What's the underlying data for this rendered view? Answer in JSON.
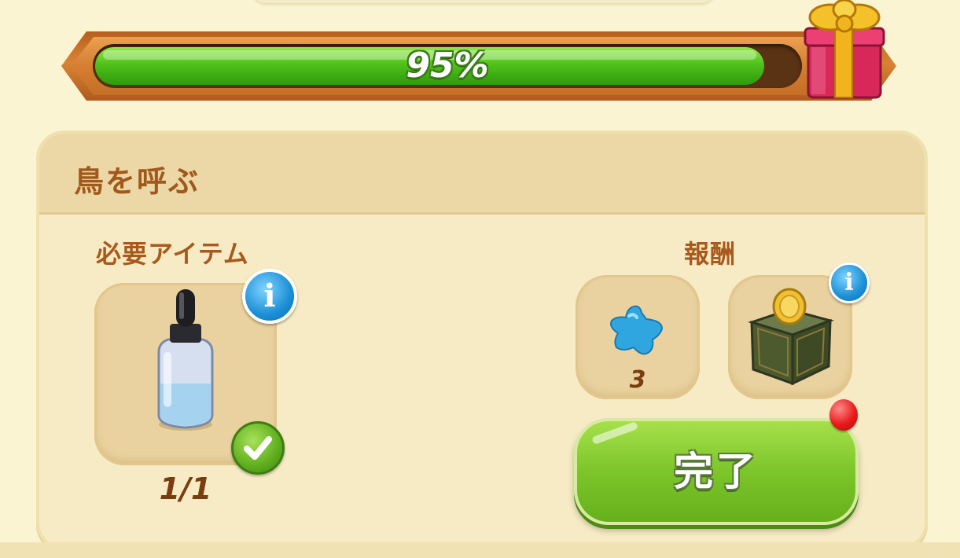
{
  "progress": {
    "label": "95%",
    "value": 0.95
  },
  "quest": {
    "title": "鳥を呼ぶ",
    "required_items": {
      "heading": "必要アイテム",
      "items": [
        {
          "icon": "dropper-bottle-icon",
          "count": "1/1",
          "completed": true
        }
      ]
    },
    "rewards": {
      "heading": "報酬",
      "items": [
        {
          "icon": "blue-star-icon",
          "count": "3"
        },
        {
          "icon": "coin-box-icon",
          "count": ""
        }
      ]
    },
    "complete_button": "完了"
  },
  "colors": {
    "progress_fill": "#4fc21a",
    "frame": "#d88434",
    "panel": "#f6ebc4",
    "title_text": "#a2581c",
    "button": "#7cc52a",
    "notify": "#e81a1a",
    "info": "#1c8fd6"
  }
}
